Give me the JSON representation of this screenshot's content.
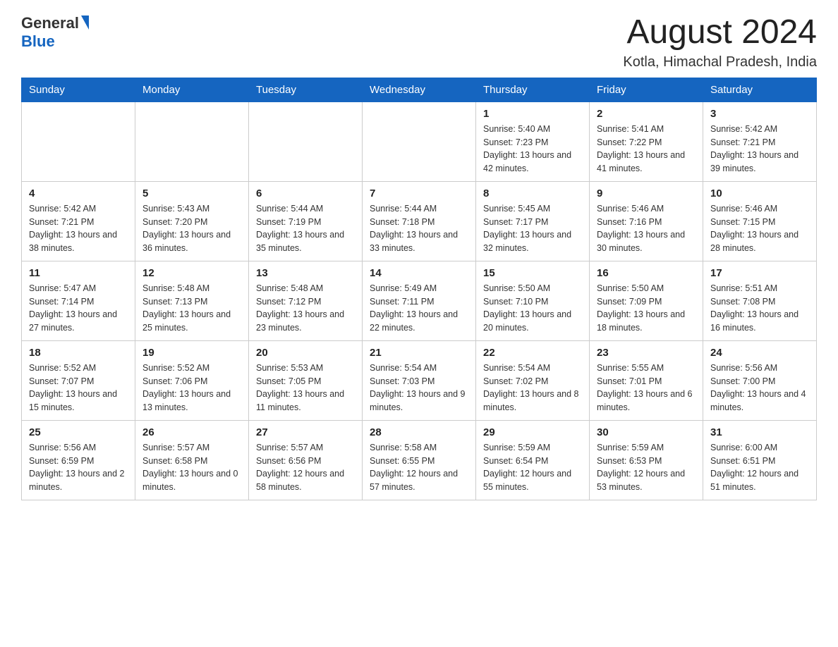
{
  "header": {
    "logo_general": "General",
    "logo_blue": "Blue",
    "month_title": "August 2024",
    "location": "Kotla, Himachal Pradesh, India"
  },
  "weekdays": [
    "Sunday",
    "Monday",
    "Tuesday",
    "Wednesday",
    "Thursday",
    "Friday",
    "Saturday"
  ],
  "weeks": [
    [
      {
        "day": "",
        "sunrise": "",
        "sunset": "",
        "daylight": ""
      },
      {
        "day": "",
        "sunrise": "",
        "sunset": "",
        "daylight": ""
      },
      {
        "day": "",
        "sunrise": "",
        "sunset": "",
        "daylight": ""
      },
      {
        "day": "",
        "sunrise": "",
        "sunset": "",
        "daylight": ""
      },
      {
        "day": "1",
        "sunrise": "Sunrise: 5:40 AM",
        "sunset": "Sunset: 7:23 PM",
        "daylight": "Daylight: 13 hours and 42 minutes."
      },
      {
        "day": "2",
        "sunrise": "Sunrise: 5:41 AM",
        "sunset": "Sunset: 7:22 PM",
        "daylight": "Daylight: 13 hours and 41 minutes."
      },
      {
        "day": "3",
        "sunrise": "Sunrise: 5:42 AM",
        "sunset": "Sunset: 7:21 PM",
        "daylight": "Daylight: 13 hours and 39 minutes."
      }
    ],
    [
      {
        "day": "4",
        "sunrise": "Sunrise: 5:42 AM",
        "sunset": "Sunset: 7:21 PM",
        "daylight": "Daylight: 13 hours and 38 minutes."
      },
      {
        "day": "5",
        "sunrise": "Sunrise: 5:43 AM",
        "sunset": "Sunset: 7:20 PM",
        "daylight": "Daylight: 13 hours and 36 minutes."
      },
      {
        "day": "6",
        "sunrise": "Sunrise: 5:44 AM",
        "sunset": "Sunset: 7:19 PM",
        "daylight": "Daylight: 13 hours and 35 minutes."
      },
      {
        "day": "7",
        "sunrise": "Sunrise: 5:44 AM",
        "sunset": "Sunset: 7:18 PM",
        "daylight": "Daylight: 13 hours and 33 minutes."
      },
      {
        "day": "8",
        "sunrise": "Sunrise: 5:45 AM",
        "sunset": "Sunset: 7:17 PM",
        "daylight": "Daylight: 13 hours and 32 minutes."
      },
      {
        "day": "9",
        "sunrise": "Sunrise: 5:46 AM",
        "sunset": "Sunset: 7:16 PM",
        "daylight": "Daylight: 13 hours and 30 minutes."
      },
      {
        "day": "10",
        "sunrise": "Sunrise: 5:46 AM",
        "sunset": "Sunset: 7:15 PM",
        "daylight": "Daylight: 13 hours and 28 minutes."
      }
    ],
    [
      {
        "day": "11",
        "sunrise": "Sunrise: 5:47 AM",
        "sunset": "Sunset: 7:14 PM",
        "daylight": "Daylight: 13 hours and 27 minutes."
      },
      {
        "day": "12",
        "sunrise": "Sunrise: 5:48 AM",
        "sunset": "Sunset: 7:13 PM",
        "daylight": "Daylight: 13 hours and 25 minutes."
      },
      {
        "day": "13",
        "sunrise": "Sunrise: 5:48 AM",
        "sunset": "Sunset: 7:12 PM",
        "daylight": "Daylight: 13 hours and 23 minutes."
      },
      {
        "day": "14",
        "sunrise": "Sunrise: 5:49 AM",
        "sunset": "Sunset: 7:11 PM",
        "daylight": "Daylight: 13 hours and 22 minutes."
      },
      {
        "day": "15",
        "sunrise": "Sunrise: 5:50 AM",
        "sunset": "Sunset: 7:10 PM",
        "daylight": "Daylight: 13 hours and 20 minutes."
      },
      {
        "day": "16",
        "sunrise": "Sunrise: 5:50 AM",
        "sunset": "Sunset: 7:09 PM",
        "daylight": "Daylight: 13 hours and 18 minutes."
      },
      {
        "day": "17",
        "sunrise": "Sunrise: 5:51 AM",
        "sunset": "Sunset: 7:08 PM",
        "daylight": "Daylight: 13 hours and 16 minutes."
      }
    ],
    [
      {
        "day": "18",
        "sunrise": "Sunrise: 5:52 AM",
        "sunset": "Sunset: 7:07 PM",
        "daylight": "Daylight: 13 hours and 15 minutes."
      },
      {
        "day": "19",
        "sunrise": "Sunrise: 5:52 AM",
        "sunset": "Sunset: 7:06 PM",
        "daylight": "Daylight: 13 hours and 13 minutes."
      },
      {
        "day": "20",
        "sunrise": "Sunrise: 5:53 AM",
        "sunset": "Sunset: 7:05 PM",
        "daylight": "Daylight: 13 hours and 11 minutes."
      },
      {
        "day": "21",
        "sunrise": "Sunrise: 5:54 AM",
        "sunset": "Sunset: 7:03 PM",
        "daylight": "Daylight: 13 hours and 9 minutes."
      },
      {
        "day": "22",
        "sunrise": "Sunrise: 5:54 AM",
        "sunset": "Sunset: 7:02 PM",
        "daylight": "Daylight: 13 hours and 8 minutes."
      },
      {
        "day": "23",
        "sunrise": "Sunrise: 5:55 AM",
        "sunset": "Sunset: 7:01 PM",
        "daylight": "Daylight: 13 hours and 6 minutes."
      },
      {
        "day": "24",
        "sunrise": "Sunrise: 5:56 AM",
        "sunset": "Sunset: 7:00 PM",
        "daylight": "Daylight: 13 hours and 4 minutes."
      }
    ],
    [
      {
        "day": "25",
        "sunrise": "Sunrise: 5:56 AM",
        "sunset": "Sunset: 6:59 PM",
        "daylight": "Daylight: 13 hours and 2 minutes."
      },
      {
        "day": "26",
        "sunrise": "Sunrise: 5:57 AM",
        "sunset": "Sunset: 6:58 PM",
        "daylight": "Daylight: 13 hours and 0 minutes."
      },
      {
        "day": "27",
        "sunrise": "Sunrise: 5:57 AM",
        "sunset": "Sunset: 6:56 PM",
        "daylight": "Daylight: 12 hours and 58 minutes."
      },
      {
        "day": "28",
        "sunrise": "Sunrise: 5:58 AM",
        "sunset": "Sunset: 6:55 PM",
        "daylight": "Daylight: 12 hours and 57 minutes."
      },
      {
        "day": "29",
        "sunrise": "Sunrise: 5:59 AM",
        "sunset": "Sunset: 6:54 PM",
        "daylight": "Daylight: 12 hours and 55 minutes."
      },
      {
        "day": "30",
        "sunrise": "Sunrise: 5:59 AM",
        "sunset": "Sunset: 6:53 PM",
        "daylight": "Daylight: 12 hours and 53 minutes."
      },
      {
        "day": "31",
        "sunrise": "Sunrise: 6:00 AM",
        "sunset": "Sunset: 6:51 PM",
        "daylight": "Daylight: 12 hours and 51 minutes."
      }
    ]
  ]
}
